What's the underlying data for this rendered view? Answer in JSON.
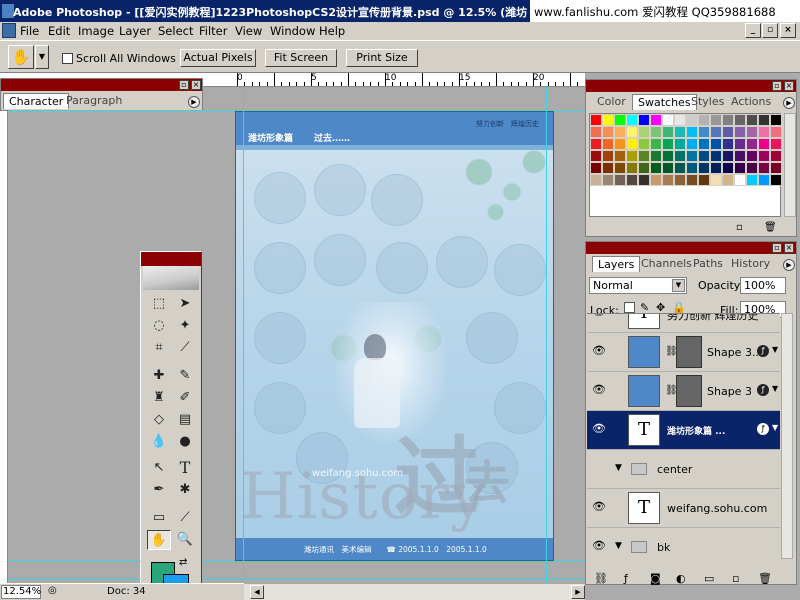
{
  "window": {
    "title": "Adobe Photoshop - [[爱闪实例教程]1223PhotoshopCS2设计宣传册背景.psd @ 12.5% (潍坊",
    "watermark": "www.fanlishu.com 爱闪教程 QQ359881688"
  },
  "menu": {
    "items": [
      "File",
      "Edit",
      "Image",
      "Layer",
      "Select",
      "Filter",
      "View",
      "Window",
      "Help"
    ]
  },
  "options_bar": {
    "scroll_all_windows": "Scroll All Windows",
    "actual_pixels": "Actual Pixels",
    "fit_screen": "Fit Screen",
    "print_size": "Print Size"
  },
  "ruler": {
    "labels": [
      "0",
      "5",
      "10",
      "15",
      "20"
    ]
  },
  "char_palette": {
    "tabs": [
      "Character",
      "Paragraph"
    ]
  },
  "canvas": {
    "top_left_text": "潍坊形象篇",
    "top_left_sub": "过去……",
    "top_right_text": "努力创新　辉煌历史",
    "guo_char": "过",
    "history_word": "History",
    "qu_char": "去",
    "sohu_text": "weifang.sohu.com",
    "bottom_text": "潍坊通讯　美术编辑　　☎ 2005.1.1.0　2005.1.1.0"
  },
  "swatches": {
    "tabs": [
      "Color",
      "Swatches",
      "Styles",
      "Actions"
    ],
    "colors": [
      "#ff0000",
      "#ffff00",
      "#00ff00",
      "#00ffff",
      "#0000ff",
      "#ff00ff",
      "#ffffff",
      "#e6e6e6",
      "#cccccc",
      "#b3b3b3",
      "#999999",
      "#808080",
      "#666666",
      "#4d4d4d",
      "#333333",
      "#000000",
      "#f26c4f",
      "#f68e55",
      "#fbaf5d",
      "#fff467",
      "#acd372",
      "#7cc576",
      "#3bb878",
      "#1abbb4",
      "#00bff3",
      "#438cca",
      "#5574b9",
      "#605ca8",
      "#855fa8",
      "#a763a8",
      "#f06ea9",
      "#f26d7d",
      "#ed1c24",
      "#f26522",
      "#f7941d",
      "#fff200",
      "#8dc63f",
      "#39b54a",
      "#00a651",
      "#00a99d",
      "#00aeef",
      "#0072bc",
      "#0054a6",
      "#2e3192",
      "#662d91",
      "#92278f",
      "#ec008c",
      "#ed145b",
      "#9e0b0f",
      "#a0410d",
      "#a3620a",
      "#aba000",
      "#598527",
      "#197b30",
      "#007236",
      "#00746b",
      "#0076a3",
      "#004a80",
      "#003471",
      "#1b1464",
      "#440e62",
      "#630460",
      "#9e005d",
      "#9e0039",
      "#790000",
      "#7b2e00",
      "#7d4900",
      "#827b00",
      "#406618",
      "#005e20",
      "#005826",
      "#005952",
      "#005b7f",
      "#003663",
      "#002157",
      "#0d004c",
      "#32004b",
      "#4b0049",
      "#7b0046",
      "#7a0026",
      "#c7b299",
      "#998675",
      "#736357",
      "#534741",
      "#37302d",
      "#c69c6d",
      "#a67c52",
      "#8c6239",
      "#754c24",
      "#603913",
      "#f5deb3",
      "#d2b48c",
      "#ffffff",
      "#00ccff",
      "#0099ff",
      "#000000"
    ]
  },
  "layers": {
    "tabs": [
      "Layers",
      "Channels",
      "Paths",
      "History"
    ],
    "blend_mode": "Normal",
    "opacity_label": "Opacity:",
    "opacity_value": "100%",
    "lock_label": "Lock:",
    "fill_label": "Fill:",
    "fill_value": "100%",
    "rows": [
      {
        "name": "努力创新 辉煌历史",
        "kind": "text"
      },
      {
        "name": "Shape 3...",
        "kind": "shape"
      },
      {
        "name": "Shape 3",
        "kind": "shape"
      },
      {
        "name": "潍坊形象篇 ...",
        "kind": "text"
      },
      {
        "name": "center",
        "kind": "group"
      },
      {
        "name": "weifang.sohu.com",
        "kind": "text"
      },
      {
        "name": "bk",
        "kind": "group"
      }
    ]
  },
  "status": {
    "zoom": "12.54%",
    "doc": "Doc: 34"
  },
  "toolbox": {
    "text_tool": "T"
  }
}
